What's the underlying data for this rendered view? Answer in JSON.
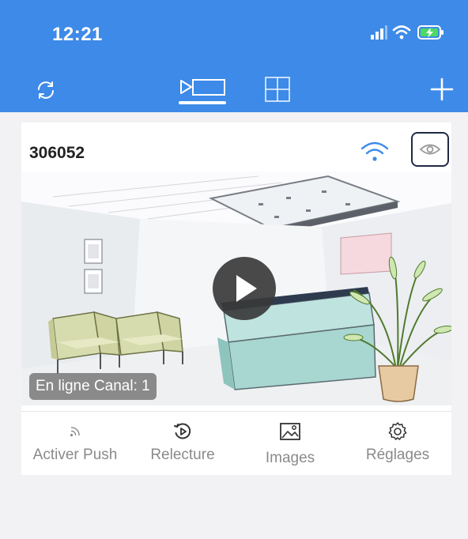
{
  "status_bar": {
    "time": "12:21",
    "icons": [
      "signal-icon",
      "wifi-icon",
      "battery-charging-icon"
    ]
  },
  "header": {
    "left_icon": "refresh-icon",
    "tabs": [
      {
        "icon": "single-view-icon",
        "active": true
      },
      {
        "icon": "grid-view-icon",
        "active": false
      }
    ],
    "right_icon": "add-icon"
  },
  "device": {
    "name": "306052",
    "connection_icon": "wifi-icon",
    "preview_icon": "eye-icon",
    "status_text": "En ligne Canal: 1",
    "play_icon": "play-icon"
  },
  "actions": [
    {
      "label": "Activer Push",
      "icon": "push-icon"
    },
    {
      "label": "Relecture",
      "icon": "replay-icon"
    },
    {
      "label": "Images",
      "icon": "image-icon"
    },
    {
      "label": "Réglages",
      "icon": "settings-icon"
    }
  ],
  "colors": {
    "header_bg": "#3d8ae8",
    "page_bg": "#f2f2f4",
    "wifi_accent": "#3d8ae8",
    "label_gray": "#8a8a8a"
  }
}
